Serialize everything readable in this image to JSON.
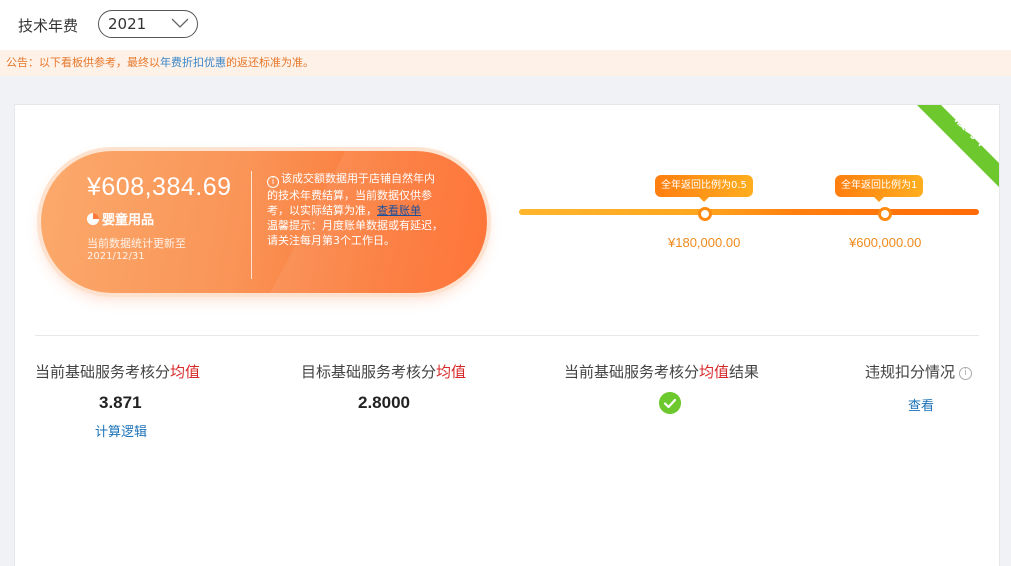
{
  "header": {
    "title": "技术年费",
    "year_select": {
      "value": "2021"
    }
  },
  "notice": {
    "prefix": "公告：以下看板供参考，最终以",
    "highlight": "年费折扣优惠",
    "suffix": "的返还标准为准。"
  },
  "summary": {
    "ribbon": "履约中",
    "amount": "¥608,384.69",
    "category": "婴童用品",
    "update_line1": "当前数据统计更新至",
    "update_line2": "2021/12/31",
    "desc_main": "该成交额数据用于店铺自然年内的技术年费结算，当前数据仅供参考，以实际结算为准，",
    "desc_link": "查看账单",
    "desc_tip": "温馨提示：月度账单数据或有延迟，请关注每月第3个工作日。"
  },
  "progress": {
    "milestones": [
      {
        "label": "全年返回比例为0.5",
        "amount": "¥180,000.00"
      },
      {
        "label": "全年返回比例为1",
        "amount": "¥600,000.00"
      }
    ]
  },
  "metrics": {
    "current_avg": {
      "label_a": "当前基础服务考核分",
      "label_b": "均值",
      "value": "3.871",
      "link": "计算逻辑"
    },
    "target_avg": {
      "label_a": "目标基础服务考核分",
      "label_b": "均值",
      "value": "2.8000"
    },
    "result": {
      "label_a": "当前基础服务考核分",
      "label_b": "均值",
      "label_c": "结果"
    },
    "violation": {
      "label": "违规扣分情况",
      "link": "查看"
    }
  },
  "colors": {
    "accent_orange": "#fb7a3a",
    "ribbon_green": "#6cc82c",
    "link_blue": "#1a72b8",
    "highlight_red": "#d62828"
  }
}
